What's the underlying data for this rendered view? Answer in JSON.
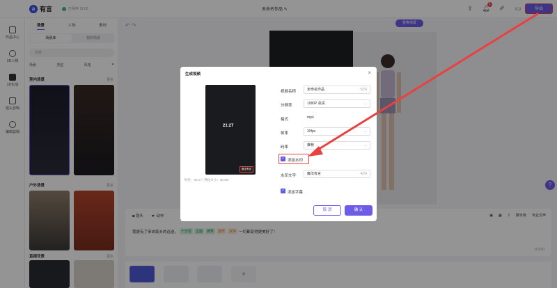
{
  "app": {
    "logo_text": "有言",
    "saved_status": "已保存 11:00",
    "project_title": "未命名作品",
    "export_label": "导出",
    "notification_count": "1"
  },
  "leftnav": {
    "items": [
      {
        "label": "作品中心",
        "icon": "folder-icon"
      },
      {
        "label": "3D人物",
        "icon": "person-icon"
      },
      {
        "label": "3D生成",
        "icon": "ai-icon"
      },
      {
        "label": "镜头剪辑",
        "icon": "camera-icon"
      },
      {
        "label": "编辑剪辑",
        "icon": "scissors-icon"
      }
    ]
  },
  "panel": {
    "tabs": [
      "场景",
      "人物",
      "素材"
    ],
    "subtabs": [
      "场景库",
      "我的场景"
    ],
    "search_placeholder": "搜索",
    "filters": [
      "场景",
      "类型",
      "风格"
    ],
    "sections": [
      {
        "title": "室内场景",
        "more": "更多"
      },
      {
        "title": "户外场景",
        "more": "更多"
      },
      {
        "title": "直播背景",
        "more": "更多"
      }
    ]
  },
  "workspace": {
    "replace_button": "替换场景"
  },
  "editor": {
    "tools": [
      "镜头",
      "动作"
    ],
    "right_tools": [
      "脚本库",
      "专业文声"
    ],
    "text_before": "我更有了来自家乡的运送，",
    "chip1": "十分恩",
    "chip2": "正面",
    "chip3": "微笑",
    "chip4": "放开",
    "chip5": "双手",
    "text_after": "一切都变得更美好了！",
    "count": "11/200"
  },
  "modal": {
    "title": "生成视频",
    "preview_time": "21:27",
    "watermark_chip": "魔法有言",
    "meta": "时长：00:17 | 预估大小：35.6M",
    "fields": {
      "name_label": "视频名称",
      "name_value": "未命名作品",
      "name_count": "5/24",
      "res_label": "分辨率",
      "res_value": "1080P 高清",
      "format_label": "格式",
      "format_value": "mp4",
      "fps_label": "帧率",
      "fps_value": "30fps",
      "bitrate_label": "码率",
      "bitrate_value": "推荐",
      "watermark_toggle": "添加水印",
      "wm_text_label": "水印文字",
      "wm_text_value": "魔法有言",
      "wm_count": "4/24",
      "subtitle_toggle": "添加字幕"
    },
    "cancel_label": "取 消",
    "ok_label": "确 认"
  },
  "colors": {
    "accent": "#6c5ce7",
    "highlight": "#e94040"
  }
}
